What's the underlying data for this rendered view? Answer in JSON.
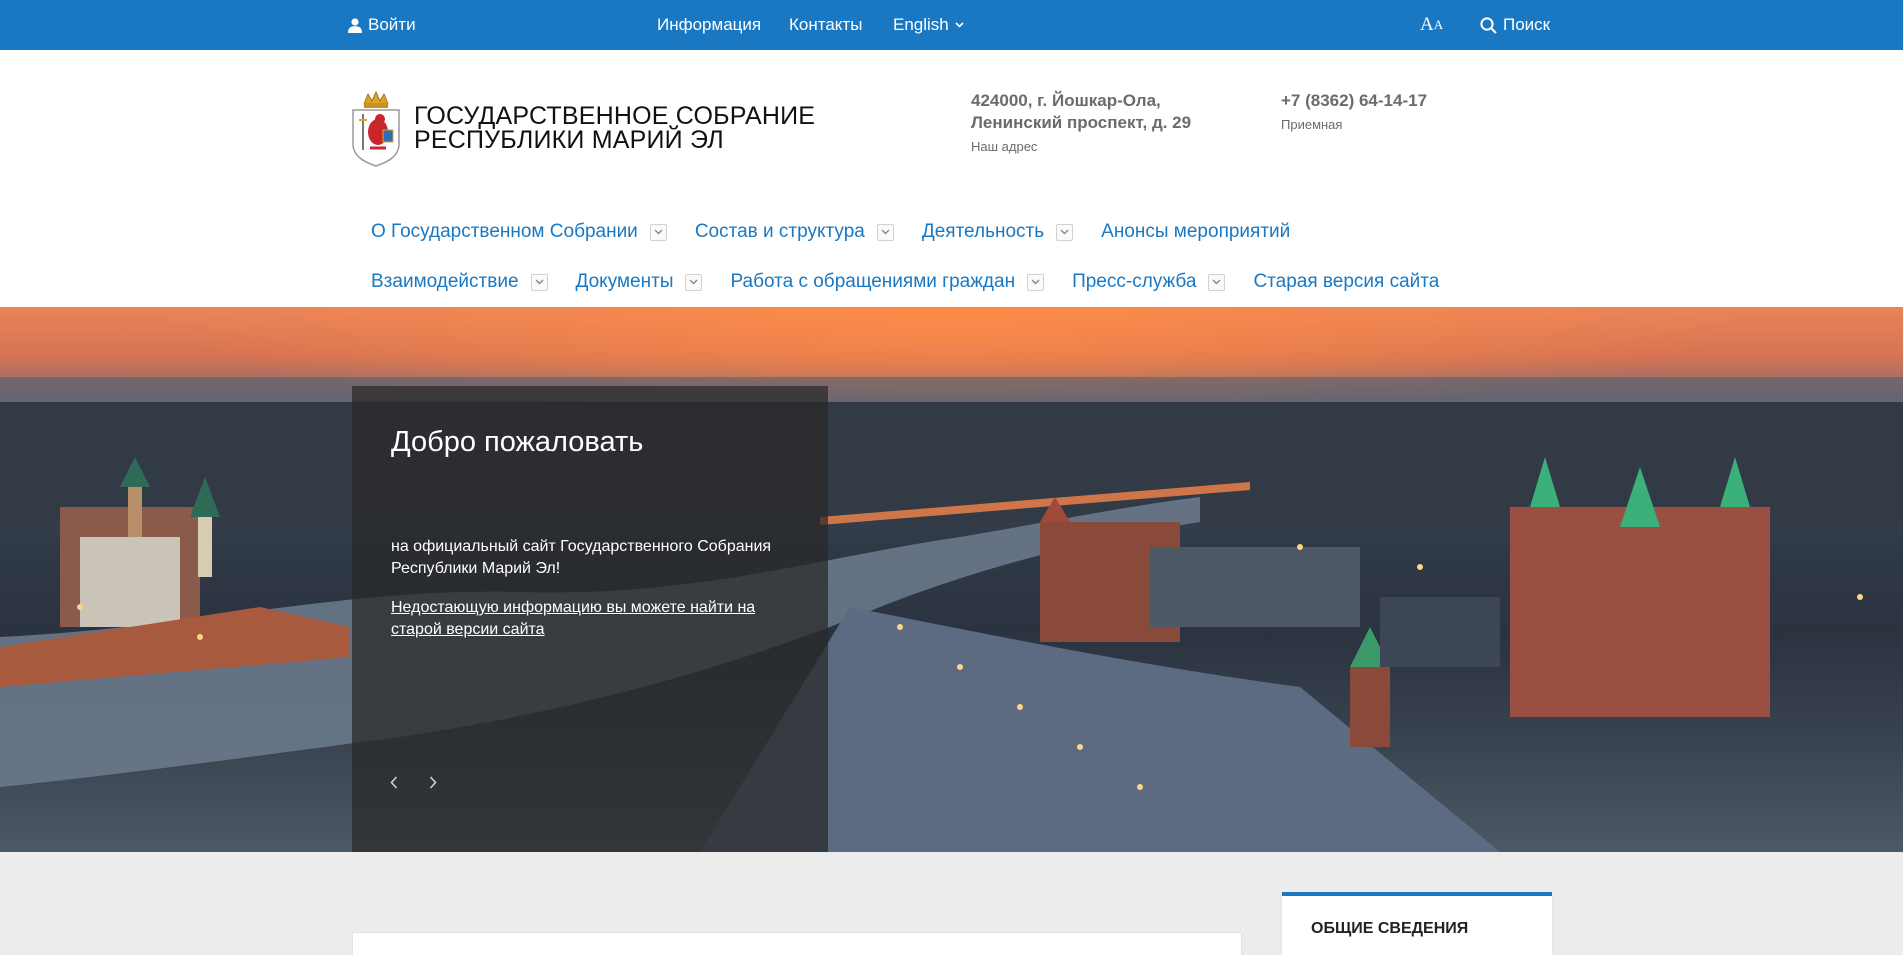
{
  "topbar": {
    "login_label": "Войти",
    "info_label": "Информация",
    "contacts_label": "Контакты",
    "language_label": "English",
    "font_size_big": "A",
    "font_size_small": "A",
    "search_label": "Поиск"
  },
  "header": {
    "title_line1": "Государственное Собрание",
    "title_line2": "Республики Марий Эл",
    "address_line1": "424000, г. Йошкар-Ола,",
    "address_line2": "Ленинский проспект, д. 29",
    "address_caption": "Наш адрес",
    "phone": "+7 (8362) 64-14-17",
    "phone_caption": "Приемная"
  },
  "nav": {
    "row1": [
      {
        "label": "О Государственном Собрании",
        "has_dropdown": true
      },
      {
        "label": "Состав и структура",
        "has_dropdown": true
      },
      {
        "label": "Деятельность",
        "has_dropdown": true
      },
      {
        "label": "Анонсы мероприятий",
        "has_dropdown": false
      }
    ],
    "row2": [
      {
        "label": "Взаимодействие",
        "has_dropdown": true
      },
      {
        "label": "Документы",
        "has_dropdown": true
      },
      {
        "label": "Работа с обращениями граждан",
        "has_dropdown": true
      },
      {
        "label": "Пресс-служба",
        "has_dropdown": true
      },
      {
        "label": "Старая версия сайта",
        "has_dropdown": false
      }
    ]
  },
  "hero": {
    "title": "Добро пожаловать",
    "text": "на официальный сайт Государственного Собрания  Республики Марий Эл!",
    "link": "Недостающую информацию вы можете найти на старой версии сайта"
  },
  "sidebar": {
    "card_title": "ОБЩИЕ СВЕДЕНИЯ"
  },
  "colors": {
    "brand_blue": "#1a78c2",
    "background": "#ececec"
  },
  "icons": {
    "login": "user-icon",
    "language": "chevron-down-icon",
    "search": "search-icon",
    "font_size": "font-size-icon"
  }
}
